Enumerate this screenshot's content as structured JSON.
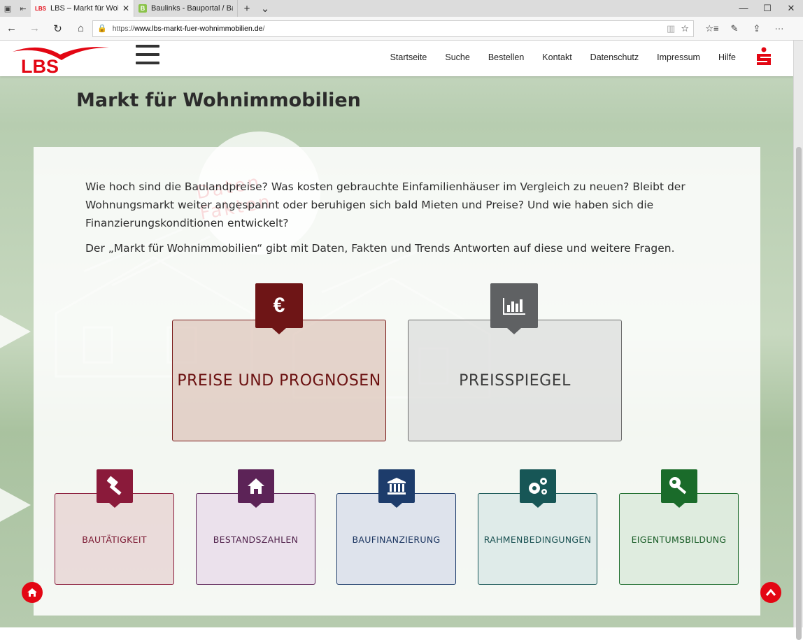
{
  "browser": {
    "tabs": [
      {
        "favicon": "LBS",
        "title": "LBS – Markt für Wohnin",
        "active": true
      },
      {
        "favicon": "B",
        "title": "Baulinks - Bauportal / Baum",
        "active": false
      }
    ],
    "url_prefix": "https://",
    "url_host": "www.lbs-markt-fuer-wohnimmobilien.de",
    "url_path": "/"
  },
  "header": {
    "logo_text": "LBS",
    "nav": [
      "Startseite",
      "Suche",
      "Bestellen",
      "Kontakt",
      "Datenschutz",
      "Impressum",
      "Hilfe"
    ]
  },
  "page": {
    "title": "Markt für Wohnimmobilien",
    "deco_text": "Daten Fakten",
    "intro_1": "Wie hoch sind die Baulandpreise? Was kosten gebrauchte Einfamilienhäuser im Vergleich zu neuen? Bleibt der Wohnungsmarkt weiter angespannt oder beruhigen sich bald Mieten und Preise? Und wie haben sich die Finanzierungskonditionen entwickelt?",
    "intro_2": "Der „Markt für Wohnimmobilien“ gibt mit Daten, Fakten und Trends Antworten auf diese und weitere Fragen."
  },
  "big_cards": [
    {
      "label": "PREISE UND PROGNOSEN",
      "icon": "euro-icon",
      "icon_glyph": "€",
      "color": "#6e1516"
    },
    {
      "label": "PREISSPIEGEL",
      "icon": "bar-chart-icon",
      "color": "#5f6163"
    }
  ],
  "small_cards": [
    {
      "label": "BAUTÄTIGKEIT",
      "icon": "gavel-icon",
      "color": "#8a1a3a",
      "text": "#7a1630",
      "bg": "rgba(226,196,196,.55)"
    },
    {
      "label": "BESTANDSZAHLEN",
      "icon": "home-icon",
      "color": "#5c2357",
      "text": "#4e1f49",
      "bg": "rgba(228,210,232,.6)"
    },
    {
      "label": "BAUFINANZIERUNG",
      "icon": "bank-icon",
      "color": "#1d3c6b",
      "text": "#1b3560",
      "bg": "rgba(206,214,232,.6)"
    },
    {
      "label": "RAHMENBEDINGUNGEN",
      "icon": "gears-icon",
      "color": "#175656",
      "text": "#174f50",
      "bg": "rgba(208,226,226,.6)"
    },
    {
      "label": "EIGENTUMSBILDUNG",
      "icon": "key-icon",
      "color": "#1a6b2a",
      "text": "#185c26",
      "bg": "rgba(208,228,210,.6)"
    }
  ]
}
